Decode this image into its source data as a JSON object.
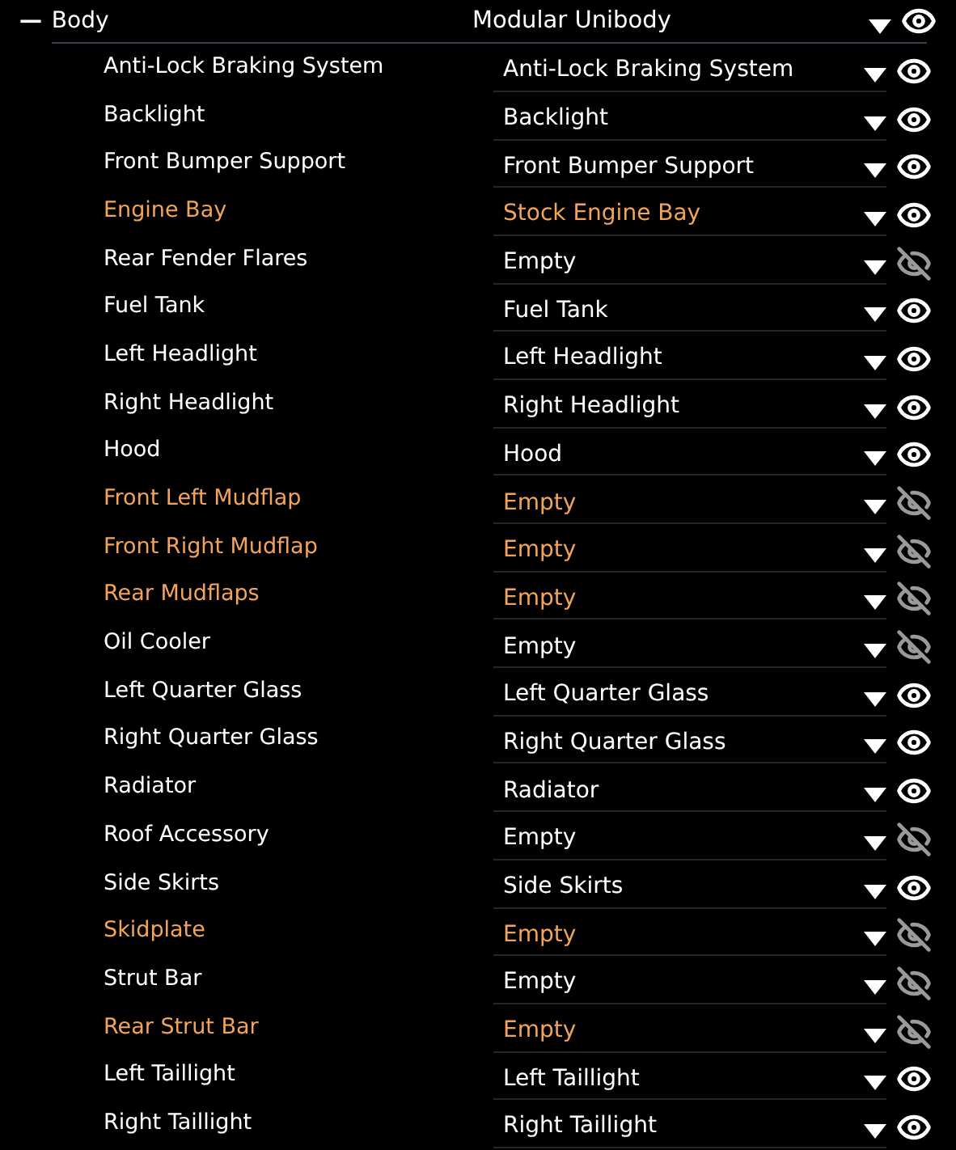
{
  "group": {
    "toggle": "—",
    "label": "Body",
    "value": "Modular Unibody",
    "expanded": true,
    "visible": true
  },
  "parts": [
    {
      "label": "Anti-Lock Braking System",
      "value": "Anti-Lock Braking System",
      "modified": false,
      "visible": true
    },
    {
      "label": "Backlight",
      "value": "Backlight",
      "modified": false,
      "visible": true
    },
    {
      "label": "Front Bumper Support",
      "value": "Front Bumper Support",
      "modified": false,
      "visible": true
    },
    {
      "label": "Engine Bay",
      "value": "Stock Engine Bay",
      "modified": true,
      "visible": true
    },
    {
      "label": "Rear Fender Flares",
      "value": "Empty",
      "modified": false,
      "visible": false
    },
    {
      "label": "Fuel Tank",
      "value": "Fuel Tank",
      "modified": false,
      "visible": true
    },
    {
      "label": "Left Headlight",
      "value": "Left Headlight",
      "modified": false,
      "visible": true
    },
    {
      "label": "Right Headlight",
      "value": "Right Headlight",
      "modified": false,
      "visible": true
    },
    {
      "label": "Hood",
      "value": "Hood",
      "modified": false,
      "visible": true
    },
    {
      "label": "Front Left Mudflap",
      "value": "Empty",
      "modified": true,
      "visible": false
    },
    {
      "label": "Front Right Mudflap",
      "value": "Empty",
      "modified": true,
      "visible": false
    },
    {
      "label": "Rear Mudflaps",
      "value": "Empty",
      "modified": true,
      "visible": false
    },
    {
      "label": "Oil Cooler",
      "value": "Empty",
      "modified": false,
      "visible": false
    },
    {
      "label": "Left Quarter Glass",
      "value": "Left Quarter Glass",
      "modified": false,
      "visible": true
    },
    {
      "label": "Right Quarter Glass",
      "value": "Right Quarter Glass",
      "modified": false,
      "visible": true
    },
    {
      "label": "Radiator",
      "value": "Radiator",
      "modified": false,
      "visible": true
    },
    {
      "label": "Roof Accessory",
      "value": "Empty",
      "modified": false,
      "visible": false
    },
    {
      "label": "Side Skirts",
      "value": "Side Skirts",
      "modified": false,
      "visible": true
    },
    {
      "label": "Skidplate",
      "value": "Empty",
      "modified": true,
      "visible": false
    },
    {
      "label": "Strut Bar",
      "value": "Empty",
      "modified": false,
      "visible": false
    },
    {
      "label": "Rear Strut Bar",
      "value": "Empty",
      "modified": true,
      "visible": false
    },
    {
      "label": "Left Taillight",
      "value": "Left Taillight",
      "modified": false,
      "visible": true
    },
    {
      "label": "Right Taillight",
      "value": "Right Taillight",
      "modified": false,
      "visible": true
    }
  ]
}
